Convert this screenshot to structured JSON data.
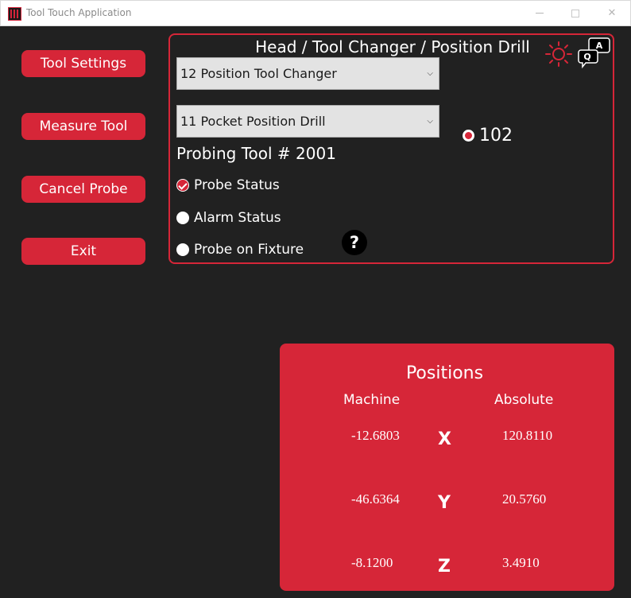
{
  "window": {
    "title": "Tool Touch Application"
  },
  "sidebar": {
    "buttons": [
      {
        "label": "Tool Settings"
      },
      {
        "label": "Measure Tool"
      },
      {
        "label": "Cancel Probe"
      },
      {
        "label": "Exit"
      }
    ]
  },
  "head_panel": {
    "title": "Head / Tool Changer / Position Drill",
    "tool_changer_select": {
      "value": "12 Position Tool Changer"
    },
    "position_drill_select": {
      "value": "11 Pocket Position Drill"
    },
    "probing_tool": "Probing Tool # 2001",
    "counter_value": "102",
    "statuses": [
      {
        "label": "Probe Status",
        "checked": true
      },
      {
        "label": "Alarm Status",
        "checked": false
      },
      {
        "label": "Probe on Fixture",
        "checked": false
      }
    ],
    "help_glyph": "?",
    "qa_icon": {
      "a": "A",
      "q": "Q"
    }
  },
  "positions": {
    "title": "Positions",
    "machine_header": "Machine",
    "absolute_header": "Absolute",
    "rows": [
      {
        "axis": "X",
        "machine": "-12.6803",
        "absolute": "120.8110"
      },
      {
        "axis": "Y",
        "machine": "-46.6364",
        "absolute": "20.5760"
      },
      {
        "axis": "Z",
        "machine": "-8.1200",
        "absolute": "3.4910"
      }
    ]
  },
  "colors": {
    "accent": "#d62638",
    "background": "#212121",
    "select_background": "#e3e3e3"
  },
  "icons": [
    "app-logo-icon",
    "minimize-icon",
    "maximize-icon",
    "close-icon",
    "sun-icon",
    "qa-chat-icon",
    "help-icon",
    "chevron-down-icon"
  ]
}
